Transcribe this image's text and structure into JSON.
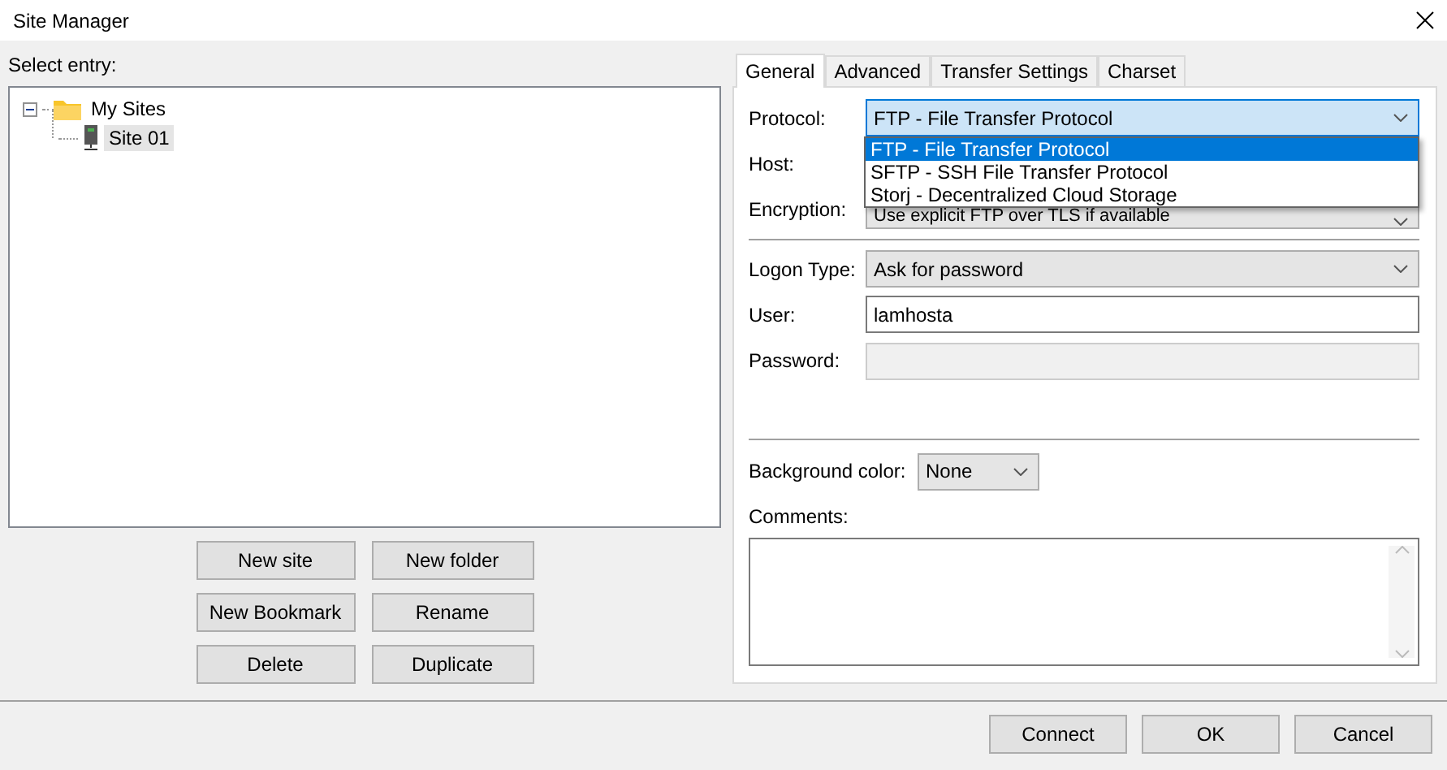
{
  "window": {
    "title": "Site Manager"
  },
  "select_entry_label": "Select entry:",
  "tree": [
    {
      "label": "My Sites",
      "kind": "folder",
      "expanded": true,
      "selected": false,
      "children": [
        {
          "label": "Site 01",
          "kind": "site",
          "selected": true
        }
      ]
    }
  ],
  "site_buttons": [
    "New site",
    "New folder",
    "New Bookmark",
    "Rename",
    "Delete",
    "Duplicate"
  ],
  "tabs": [
    {
      "label": "General",
      "selected": true
    },
    {
      "label": "Advanced",
      "selected": false
    },
    {
      "label": "Transfer Settings",
      "selected": false
    },
    {
      "label": "Charset",
      "selected": false
    }
  ],
  "protocol": {
    "label": "Protocol:",
    "value": "FTP - File Transfer Protocol",
    "open": true,
    "options": [
      {
        "label": "FTP - File Transfer Protocol",
        "selected": true
      },
      {
        "label": "SFTP - SSH File Transfer Protocol",
        "selected": false
      },
      {
        "label": "Storj - Decentralized Cloud Storage",
        "selected": false
      }
    ]
  },
  "host": {
    "label": "Host:"
  },
  "encryption": {
    "label": "Encryption:",
    "value": "Use explicit FTP over TLS if available"
  },
  "logon_type": {
    "label": "Logon Type:",
    "value": "Ask for password"
  },
  "user": {
    "label": "User:",
    "value": "lamhosta"
  },
  "password": {
    "label": "Password:",
    "disabled": true
  },
  "background_color": {
    "label": "Background color:",
    "value": "None"
  },
  "comments": {
    "label": "Comments:"
  },
  "dialog_buttons": [
    "Connect",
    "OK",
    "Cancel"
  ]
}
